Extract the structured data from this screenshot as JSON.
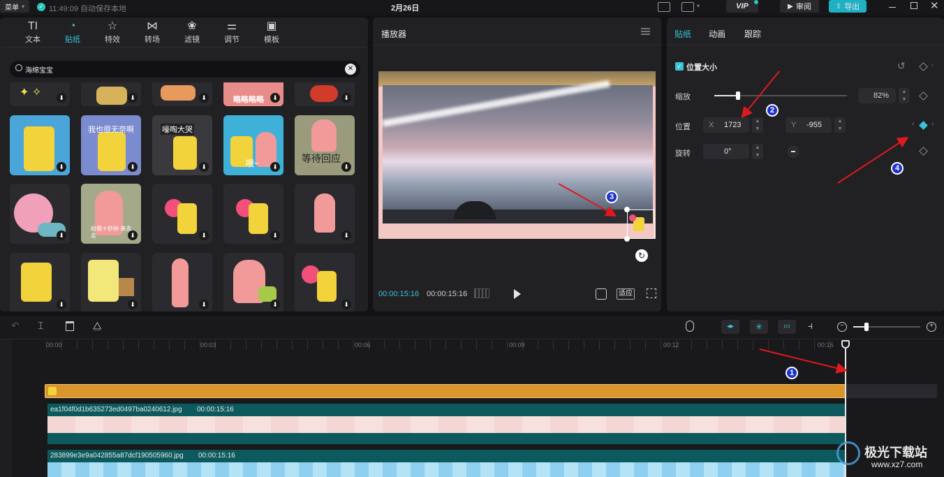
{
  "topbar": {
    "menu_label": "菜单",
    "autosave_text": "11:49:09 自动保存本地",
    "date_title": "2月26日",
    "vip_label": "VIP",
    "review_label": "审阅",
    "export_label": "导出"
  },
  "library": {
    "tabs": [
      {
        "icon": "text-icon",
        "glyph": "TI",
        "label": "文本"
      },
      {
        "icon": "sticker-icon",
        "glyph": "◔",
        "label": "贴纸"
      },
      {
        "icon": "effects-icon",
        "glyph": "☆",
        "label": "特效"
      },
      {
        "icon": "transition-icon",
        "glyph": "⋈",
        "label": "转场"
      },
      {
        "icon": "filter-icon",
        "glyph": "❀",
        "label": "滤镜"
      },
      {
        "icon": "adjust-icon",
        "glyph": "⚌",
        "label": "调节"
      },
      {
        "icon": "template-icon",
        "glyph": "▣",
        "label": "模板"
      }
    ],
    "active_tab": "贴纸",
    "search_value": "海绵宝宝",
    "sticker_texts": {
      "r0c3": "略略略略",
      "r1c1": "我也很无奈啊",
      "r1c2": "嚎啕大哭",
      "r1c3": "哦~",
      "r1c4": "等待回应",
      "r2c1": "给我十秒钟 来去走"
    }
  },
  "player": {
    "title": "播放器",
    "current_time": "00:00:15:16",
    "total_time": "00:00:15:16",
    "fit_label": "适应"
  },
  "inspector": {
    "tabs": [
      "贴纸",
      "动画",
      "跟踪"
    ],
    "section_title": "位置大小",
    "scale_label": "缩放",
    "scale_value": "82%",
    "scale_fraction": 0.18,
    "position_label": "位置",
    "x_label": "X",
    "x_value": "1723",
    "y_label": "Y",
    "y_value": "-955",
    "rotate_label": "旋转",
    "rotate_value": "0°"
  },
  "annotations": [
    "1",
    "2",
    "3",
    "4"
  ],
  "timeline": {
    "ruler": [
      "00:00",
      "00:03",
      "00:06",
      "00:09",
      "00:12",
      "00:15"
    ],
    "tracks": [
      {
        "label": "ea1f04f0d1b635273ed0497ba0240612.jpg",
        "duration": "00:00:15:16"
      },
      {
        "label": "283899e3e9a042855a87dcf190505960.jpg",
        "duration": "00:00:15:16"
      }
    ],
    "zoom_fraction": 0.2
  },
  "watermark": {
    "title": "极光下载站",
    "url": "www.xz7.com"
  },
  "colors": {
    "accent": "#38c4d8",
    "sticker_track": "#d9952c",
    "media_track": "#0c5a5e",
    "annotation_arrow": "#e0191f",
    "annotation_marker": "#1d33c8"
  }
}
